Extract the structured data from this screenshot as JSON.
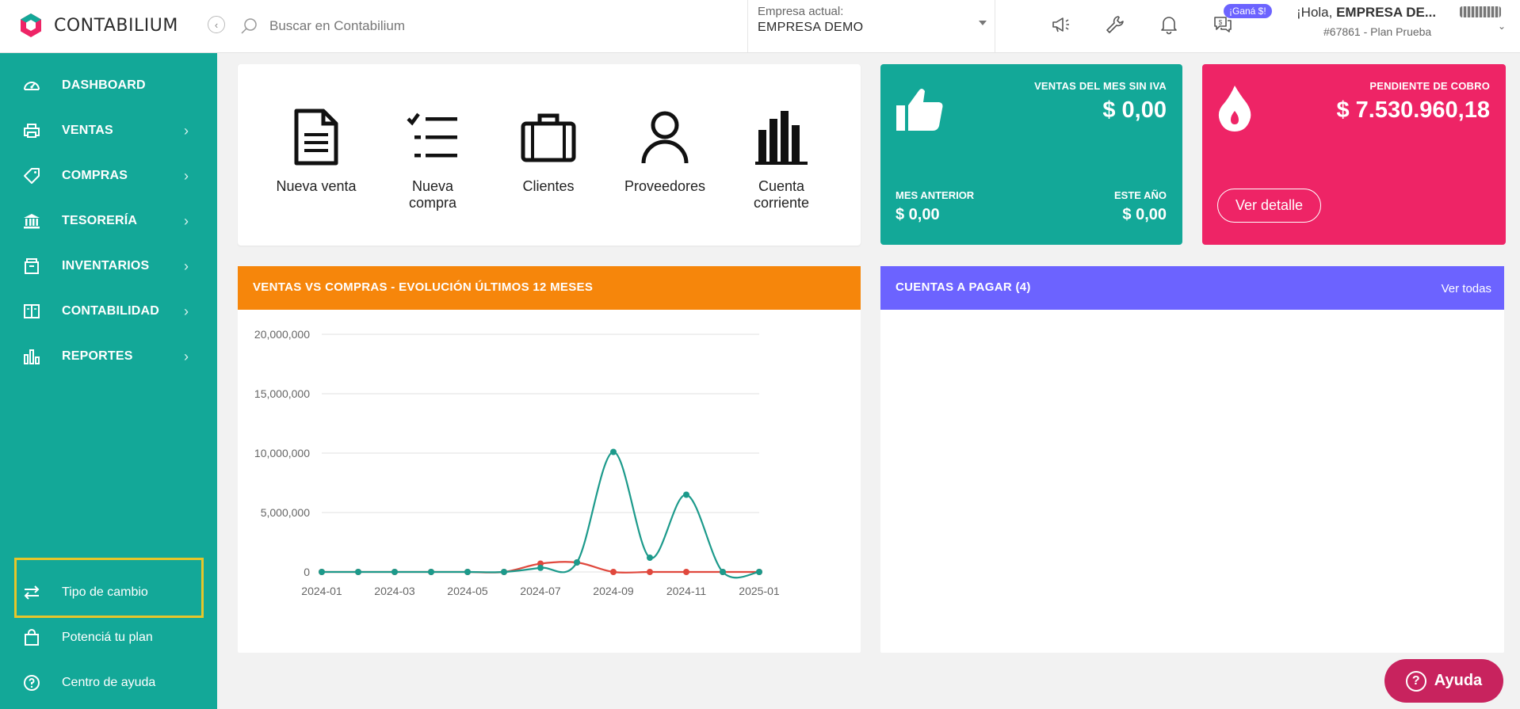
{
  "app": {
    "name": "CONTABILIUM",
    "search_placeholder": "Buscar en Contabilium"
  },
  "company": {
    "label": "Empresa actual:",
    "value": "EMPRESA DEMO"
  },
  "top_icons": [
    "megaphone-icon",
    "wrench-icon",
    "bell-icon",
    "chat-money-icon"
  ],
  "promo_badge": "¡Ganá $!",
  "user": {
    "greeting": "¡Hola,",
    "name": "EMPRESA DE...",
    "plan": "#67861 - Plan Prueba"
  },
  "sidebar": {
    "items": [
      {
        "label": "DASHBOARD",
        "icon": "dashboard-icon",
        "has_submenu": false
      },
      {
        "label": "VENTAS",
        "icon": "printer-icon",
        "has_submenu": true
      },
      {
        "label": "COMPRAS",
        "icon": "tag-icon",
        "has_submenu": true
      },
      {
        "label": "TESORERÍA",
        "icon": "bank-icon",
        "has_submenu": true
      },
      {
        "label": "INVENTARIOS",
        "icon": "box-icon",
        "has_submenu": true
      },
      {
        "label": "CONTABILIDAD",
        "icon": "book-icon",
        "has_submenu": true
      },
      {
        "label": "REPORTES",
        "icon": "bar-chart-icon",
        "has_submenu": true
      }
    ],
    "bottom": [
      {
        "label": "Tipo de cambio",
        "icon": "exchange-icon"
      },
      {
        "label": "Potenciá tu plan",
        "icon": "shopping-bag-icon"
      },
      {
        "label": "Centro de ayuda",
        "icon": "help-circle-icon"
      }
    ]
  },
  "quick_actions": [
    {
      "label": "Nueva venta",
      "icon": "document-icon"
    },
    {
      "label": "Nueva compra",
      "icon": "checklist-icon"
    },
    {
      "label": "Clientes",
      "icon": "briefcase-icon"
    },
    {
      "label": "Proveedores",
      "icon": "person-icon"
    },
    {
      "label": "Cuenta corriente",
      "icon": "bars-icon"
    }
  ],
  "ventas_card": {
    "label": "VENTAS DEL MES SIN IVA",
    "value": "$ 0,00",
    "prev_label": "MES ANTERIOR",
    "prev_value": "$ 0,00",
    "year_label": "ESTE AÑO",
    "year_value": "$ 0,00",
    "color": "#13a898"
  },
  "cobro_card": {
    "label": "PENDIENTE DE COBRO",
    "value": "$ 7.530.960,18",
    "button": "Ver detalle",
    "color": "#ee2466"
  },
  "chart_panel": {
    "title": "VENTAS VS COMPRAS - EVOLUCIÓN ÚLTIMOS 12 MESES",
    "color": "#f6860b"
  },
  "chart_data": {
    "type": "line",
    "x": [
      "2024-01",
      "2024-02",
      "2024-03",
      "2024-04",
      "2024-05",
      "2024-06",
      "2024-07",
      "2024-08",
      "2024-09",
      "2024-10",
      "2024-11",
      "2024-12",
      "2025-01"
    ],
    "x_tick_labels": [
      "2024-01",
      "2024-03",
      "2024-05",
      "2024-07",
      "2024-09",
      "2024-11",
      "2025-01"
    ],
    "y_ticks": [
      0,
      5000000,
      10000000,
      15000000,
      20000000
    ],
    "y_tick_labels": [
      "0",
      "5,000,000",
      "10,000,000",
      "15,000,000",
      "20,000,000"
    ],
    "ylim": [
      0,
      20000000
    ],
    "grid": true,
    "smooth": true,
    "series": [
      {
        "color": "#e0483d",
        "values": [
          0,
          0,
          0,
          0,
          0,
          0,
          700000,
          800000,
          0,
          0,
          0,
          0,
          0
        ]
      },
      {
        "color": "#1c9a8b",
        "values": [
          0,
          0,
          0,
          0,
          0,
          0,
          350000,
          800000,
          10100000,
          1200000,
          6500000,
          0,
          0
        ]
      }
    ]
  },
  "cuentas_panel": {
    "title": "CUENTAS A PAGAR (4)",
    "link": "Ver todas",
    "color": "#6c63ff"
  },
  "help_button": "Ayuda"
}
